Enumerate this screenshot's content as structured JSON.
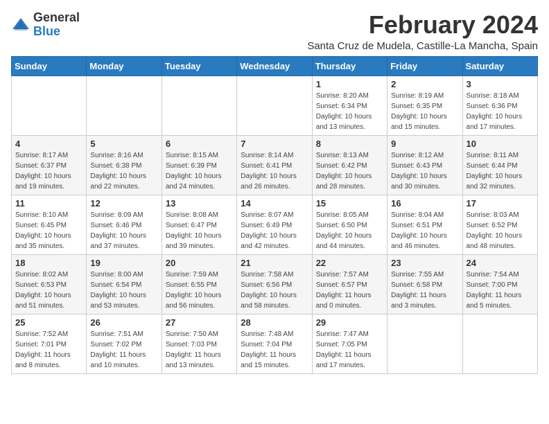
{
  "header": {
    "logo_general": "General",
    "logo_blue": "Blue",
    "month_title": "February 2024",
    "location": "Santa Cruz de Mudela, Castille-La Mancha, Spain"
  },
  "days_of_week": [
    "Sunday",
    "Monday",
    "Tuesday",
    "Wednesday",
    "Thursday",
    "Friday",
    "Saturday"
  ],
  "weeks": [
    [
      {
        "day": "",
        "info": ""
      },
      {
        "day": "",
        "info": ""
      },
      {
        "day": "",
        "info": ""
      },
      {
        "day": "",
        "info": ""
      },
      {
        "day": "1",
        "info": "Sunrise: 8:20 AM\nSunset: 6:34 PM\nDaylight: 10 hours\nand 13 minutes."
      },
      {
        "day": "2",
        "info": "Sunrise: 8:19 AM\nSunset: 6:35 PM\nDaylight: 10 hours\nand 15 minutes."
      },
      {
        "day": "3",
        "info": "Sunrise: 8:18 AM\nSunset: 6:36 PM\nDaylight: 10 hours\nand 17 minutes."
      }
    ],
    [
      {
        "day": "4",
        "info": "Sunrise: 8:17 AM\nSunset: 6:37 PM\nDaylight: 10 hours\nand 19 minutes."
      },
      {
        "day": "5",
        "info": "Sunrise: 8:16 AM\nSunset: 6:38 PM\nDaylight: 10 hours\nand 22 minutes."
      },
      {
        "day": "6",
        "info": "Sunrise: 8:15 AM\nSunset: 6:39 PM\nDaylight: 10 hours\nand 24 minutes."
      },
      {
        "day": "7",
        "info": "Sunrise: 8:14 AM\nSunset: 6:41 PM\nDaylight: 10 hours\nand 26 minutes."
      },
      {
        "day": "8",
        "info": "Sunrise: 8:13 AM\nSunset: 6:42 PM\nDaylight: 10 hours\nand 28 minutes."
      },
      {
        "day": "9",
        "info": "Sunrise: 8:12 AM\nSunset: 6:43 PM\nDaylight: 10 hours\nand 30 minutes."
      },
      {
        "day": "10",
        "info": "Sunrise: 8:11 AM\nSunset: 6:44 PM\nDaylight: 10 hours\nand 32 minutes."
      }
    ],
    [
      {
        "day": "11",
        "info": "Sunrise: 8:10 AM\nSunset: 6:45 PM\nDaylight: 10 hours\nand 35 minutes."
      },
      {
        "day": "12",
        "info": "Sunrise: 8:09 AM\nSunset: 6:46 PM\nDaylight: 10 hours\nand 37 minutes."
      },
      {
        "day": "13",
        "info": "Sunrise: 8:08 AM\nSunset: 6:47 PM\nDaylight: 10 hours\nand 39 minutes."
      },
      {
        "day": "14",
        "info": "Sunrise: 8:07 AM\nSunset: 6:49 PM\nDaylight: 10 hours\nand 42 minutes."
      },
      {
        "day": "15",
        "info": "Sunrise: 8:05 AM\nSunset: 6:50 PM\nDaylight: 10 hours\nand 44 minutes."
      },
      {
        "day": "16",
        "info": "Sunrise: 8:04 AM\nSunset: 6:51 PM\nDaylight: 10 hours\nand 46 minutes."
      },
      {
        "day": "17",
        "info": "Sunrise: 8:03 AM\nSunset: 6:52 PM\nDaylight: 10 hours\nand 48 minutes."
      }
    ],
    [
      {
        "day": "18",
        "info": "Sunrise: 8:02 AM\nSunset: 6:53 PM\nDaylight: 10 hours\nand 51 minutes."
      },
      {
        "day": "19",
        "info": "Sunrise: 8:00 AM\nSunset: 6:54 PM\nDaylight: 10 hours\nand 53 minutes."
      },
      {
        "day": "20",
        "info": "Sunrise: 7:59 AM\nSunset: 6:55 PM\nDaylight: 10 hours\nand 56 minutes."
      },
      {
        "day": "21",
        "info": "Sunrise: 7:58 AM\nSunset: 6:56 PM\nDaylight: 10 hours\nand 58 minutes."
      },
      {
        "day": "22",
        "info": "Sunrise: 7:57 AM\nSunset: 6:57 PM\nDaylight: 11 hours\nand 0 minutes."
      },
      {
        "day": "23",
        "info": "Sunrise: 7:55 AM\nSunset: 6:58 PM\nDaylight: 11 hours\nand 3 minutes."
      },
      {
        "day": "24",
        "info": "Sunrise: 7:54 AM\nSunset: 7:00 PM\nDaylight: 11 hours\nand 5 minutes."
      }
    ],
    [
      {
        "day": "25",
        "info": "Sunrise: 7:52 AM\nSunset: 7:01 PM\nDaylight: 11 hours\nand 8 minutes."
      },
      {
        "day": "26",
        "info": "Sunrise: 7:51 AM\nSunset: 7:02 PM\nDaylight: 11 hours\nand 10 minutes."
      },
      {
        "day": "27",
        "info": "Sunrise: 7:50 AM\nSunset: 7:03 PM\nDaylight: 11 hours\nand 13 minutes."
      },
      {
        "day": "28",
        "info": "Sunrise: 7:48 AM\nSunset: 7:04 PM\nDaylight: 11 hours\nand 15 minutes."
      },
      {
        "day": "29",
        "info": "Sunrise: 7:47 AM\nSunset: 7:05 PM\nDaylight: 11 hours\nand 17 minutes."
      },
      {
        "day": "",
        "info": ""
      },
      {
        "day": "",
        "info": ""
      }
    ]
  ]
}
